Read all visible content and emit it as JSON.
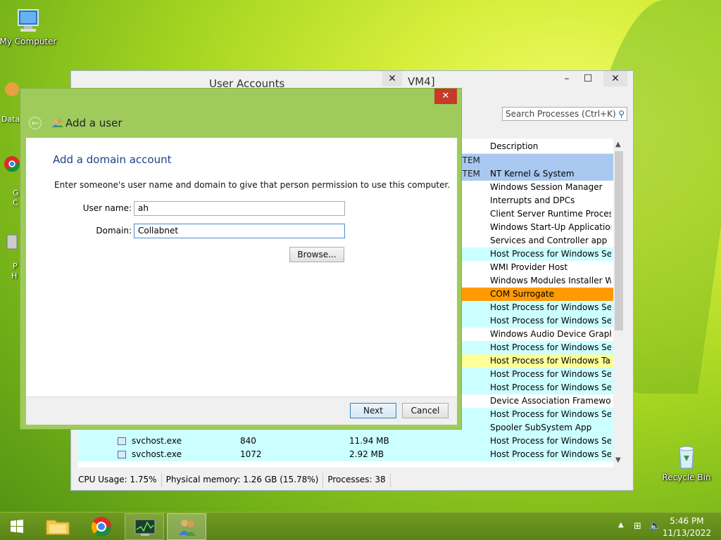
{
  "desktop": {
    "icons": {
      "my_computer": "My Computer",
      "recycle_bin": "Recycle Bin"
    },
    "partial_labels": [
      "Data",
      "G",
      "C",
      "P",
      "H"
    ]
  },
  "task_manager": {
    "title_fragment": "VM4]",
    "search_placeholder": "Search Processes (Ctrl+K)",
    "column_description": "Description",
    "rows": [
      {
        "user": "STEM",
        "desc": "",
        "bg": "#a9c8ef"
      },
      {
        "user": "STEM",
        "desc": "NT Kernel & System",
        "bg": "#a9c8ef"
      },
      {
        "user": "",
        "desc": "Windows Session Manager",
        "bg": "#ffffff"
      },
      {
        "user": "",
        "desc": "Interrupts and DPCs",
        "bg": "#ffffff"
      },
      {
        "user": "",
        "desc": "Client Server Runtime Process",
        "bg": "#ffffff"
      },
      {
        "user": "",
        "desc": "Windows Start-Up Application",
        "bg": "#ffffff"
      },
      {
        "user": "",
        "desc": "Services and Controller app",
        "bg": "#ffffff"
      },
      {
        "user": "",
        "desc": "Host Process for Windows Ser...",
        "bg": "#ccffff"
      },
      {
        "user": "",
        "desc": "WMI Provider Host",
        "bg": "#ffffff"
      },
      {
        "user": "",
        "desc": "Windows Modules Installer W...",
        "bg": "#ffffff"
      },
      {
        "user": "",
        "desc": "COM Surrogate",
        "bg": "#ff9a00"
      },
      {
        "user": "",
        "desc": "Host Process for Windows Ser...",
        "bg": "#ccffff"
      },
      {
        "user": "",
        "desc": "Host Process for Windows Ser...",
        "bg": "#ccffff"
      },
      {
        "user": "",
        "desc": "Windows Audio Device Graph...",
        "bg": "#ffffff"
      },
      {
        "user": "",
        "desc": "Host Process for Windows Ser...",
        "bg": "#ccffff"
      },
      {
        "user": "",
        "desc": "Host Process for Windows Tas...",
        "bg": "#ffff99"
      },
      {
        "user": "",
        "desc": "Host Process for Windows Ser...",
        "bg": "#ccffff"
      },
      {
        "user": "",
        "desc": "Host Process for Windows Ser...",
        "bg": "#ccffff"
      },
      {
        "user": "",
        "desc": "Device Association Framewor...",
        "bg": "#ffffff"
      },
      {
        "user": "",
        "desc": "Host Process for Windows Ser...",
        "bg": "#ccffff"
      },
      {
        "user": "",
        "desc": "Spooler SubSystem App",
        "bg": "#ccffff"
      },
      {
        "user": "",
        "name": "svchost.exe",
        "pid": "840",
        "mem": "11.94 MB",
        "desc": "Host Process for Windows Ser...",
        "bg": "#ccffff"
      },
      {
        "user": "",
        "name": "svchost.exe",
        "pid": "1072",
        "mem": "2.92 MB",
        "desc": "Host Process for Windows Ser...",
        "bg": "#ccffff"
      }
    ],
    "status": {
      "cpu": "CPU Usage: 1.75%",
      "memory": "Physical memory: 1.26 GB (15.78%)",
      "processes": "Processes: 38"
    }
  },
  "user_accounts_window": {
    "title": "User Accounts"
  },
  "dialog": {
    "title": "Add a user",
    "heading": "Add a domain account",
    "instruction": "Enter someone's user name and domain to give that person permission to use this computer.",
    "user_name_label": "User name:",
    "user_name_value": "ah",
    "domain_label": "Domain:",
    "domain_value": "Collabnet",
    "browse_label": "Browse...",
    "next_label": "Next",
    "cancel_label": "Cancel"
  },
  "taskbar": {
    "time": "5:46 PM",
    "date": "11/13/2022"
  },
  "colors": {
    "dialog_frame": "#9fcb5c",
    "close_button": "#c7392b",
    "heading_blue": "#1e3f8a",
    "taskbar": "#6f9a20"
  }
}
